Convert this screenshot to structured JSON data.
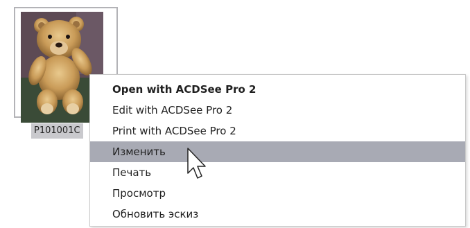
{
  "file": {
    "name": "P101001C",
    "thumbnail": "teddy-bear-photo"
  },
  "context_menu": {
    "items": [
      {
        "label": "Open with ACDSee Pro 2",
        "bold": true
      },
      {
        "label": "Edit with ACDSee Pro 2"
      },
      {
        "label": "Print with ACDSee Pro 2"
      },
      {
        "label": "Изменить",
        "highlighted": true
      },
      {
        "label": "Печать"
      },
      {
        "label": "Просмотр"
      },
      {
        "label": "Обновить эскиз"
      }
    ]
  },
  "colors": {
    "highlight": "#a8aab4",
    "label_selection": "#c9c9cd",
    "tile_border": "#b3b3b7"
  },
  "cursor": {
    "icon": "arrow-cursor-icon"
  }
}
